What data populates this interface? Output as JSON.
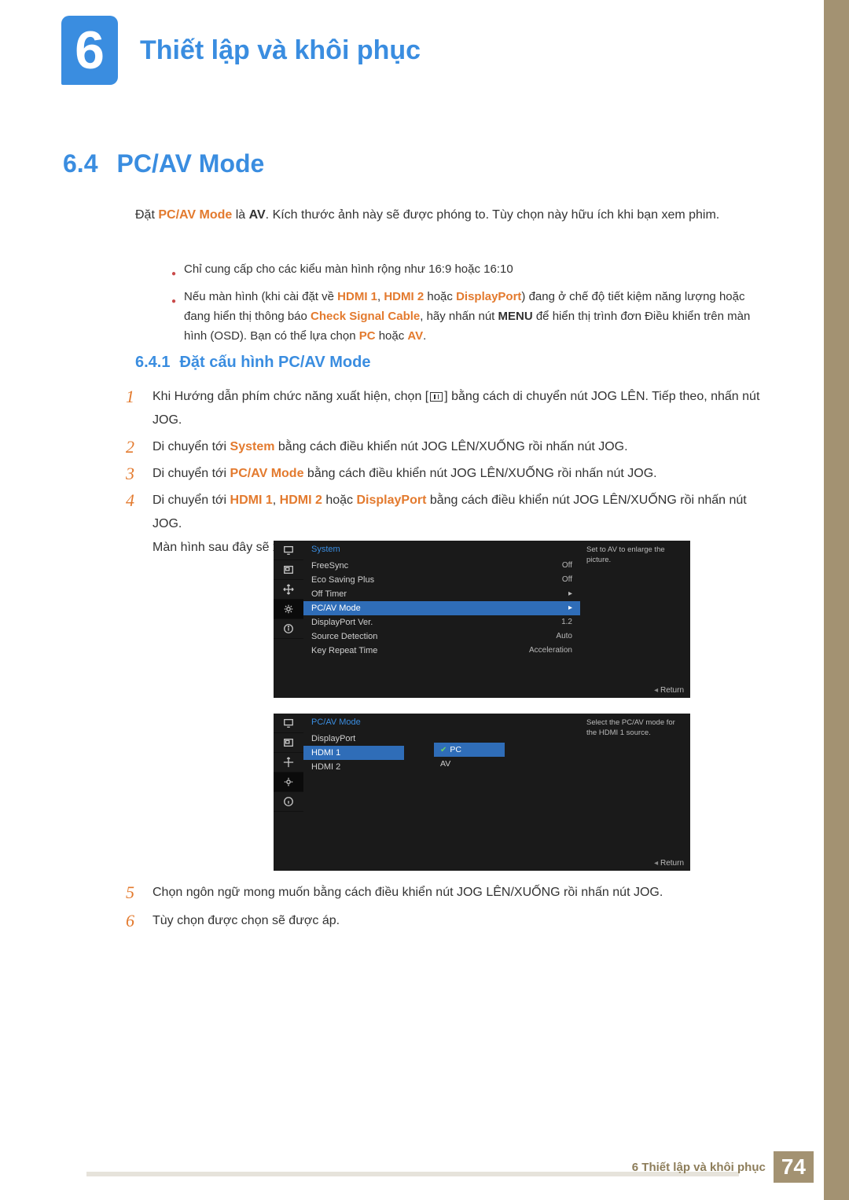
{
  "chapter": {
    "number": "6",
    "title": "Thiết lập và khôi phục"
  },
  "section": {
    "number": "6.4",
    "name": "PC/AV Mode"
  },
  "intro": {
    "t1": "Đặt ",
    "m1": "PC/AV Mode",
    "t2": " là ",
    "m2": "AV",
    "t3": ". Kích thước ảnh này sẽ được phóng to. Tùy chọn này hữu ích khi bạn xem phim."
  },
  "bullets": {
    "b1": "Chỉ cung cấp cho các kiểu màn hình rộng như 16:9 hoặc 16:10",
    "b2a": "Nếu màn hình (khi cài đặt về ",
    "b2h1": "HDMI 1",
    "b2c1": ", ",
    "b2h2": "HDMI 2",
    "b2c2": " hoặc ",
    "b2dp": "DisplayPort",
    "b2b": ") đang ở chế độ tiết kiệm năng lượng hoặc đang hiển thị thông báo ",
    "b2chk": "Check Signal Cable",
    "b2c3": ", hãy nhấn nút ",
    "b2menu": "MENU",
    "b2d": " để hiển thị trình đơn Điều khiển trên màn hình (OSD). Bạn có thể lựa chọn ",
    "b2pc": "PC",
    "b2c4": " hoặc ",
    "b2av": "AV",
    "b2e": "."
  },
  "subsection": {
    "number": "6.4.1",
    "name": "Đặt cấu hình PC/AV Mode"
  },
  "steps": {
    "s1a": "Khi Hướng dẫn phím chức năng xuất hiện, chọn [",
    "s1b": "] bằng cách di chuyển nút JOG LÊN. Tiếp theo, nhấn nút JOG.",
    "s2a": "Di chuyển tới ",
    "s2m": "System",
    "s2b": " bằng cách điều khiển nút JOG LÊN/XUỐNG rồi nhấn nút JOG.",
    "s3a": "Di chuyển tới ",
    "s3m": "PC/AV Mode",
    "s3b": " bằng cách điều khiển nút JOG LÊN/XUỐNG rồi nhấn nút JOG.",
    "s4a": "Di chuyển tới ",
    "s4h1": "HDMI 1",
    "s4c1": ", ",
    "s4h2": "HDMI 2",
    "s4c2": " hoặc ",
    "s4dp": "DisplayPort",
    "s4b": " bằng cách điều khiển nút JOG LÊN/XUỐNG rồi nhấn nút JOG.",
    "s4f": "Màn hình sau đây sẽ xuất hiện.",
    "s5": "Chọn ngôn ngữ mong muốn bằng cách điều khiển nút JOG LÊN/XUỐNG rồi nhấn nút JOG.",
    "s6": "Tùy chọn được chọn sẽ được áp."
  },
  "osd1": {
    "title": "System",
    "tip": "Set to AV to enlarge the picture.",
    "rows": [
      {
        "l": "FreeSync",
        "v": "Off"
      },
      {
        "l": "Eco Saving Plus",
        "v": "Off"
      },
      {
        "l": "Off Timer",
        "v": "▸"
      },
      {
        "l": "PC/AV Mode",
        "v": "▸",
        "sel": true
      },
      {
        "l": "DisplayPort Ver.",
        "v": "1.2"
      },
      {
        "l": "Source Detection",
        "v": "Auto"
      },
      {
        "l": "Key Repeat Time",
        "v": "Acceleration"
      }
    ],
    "return": "Return"
  },
  "osd2": {
    "title": "PC/AV Mode",
    "tip": "Select the PC/AV mode for the HDMI 1 source.",
    "rows": [
      {
        "l": "DisplayPort"
      },
      {
        "l": "HDMI 1",
        "sel": true
      },
      {
        "l": "HDMI 2"
      }
    ],
    "sub": [
      {
        "l": "PC",
        "sel": true,
        "chk": true
      },
      {
        "l": "AV"
      }
    ],
    "return": "Return"
  },
  "footer": {
    "text": "6 Thiết lập và khôi phục",
    "page": "74"
  }
}
